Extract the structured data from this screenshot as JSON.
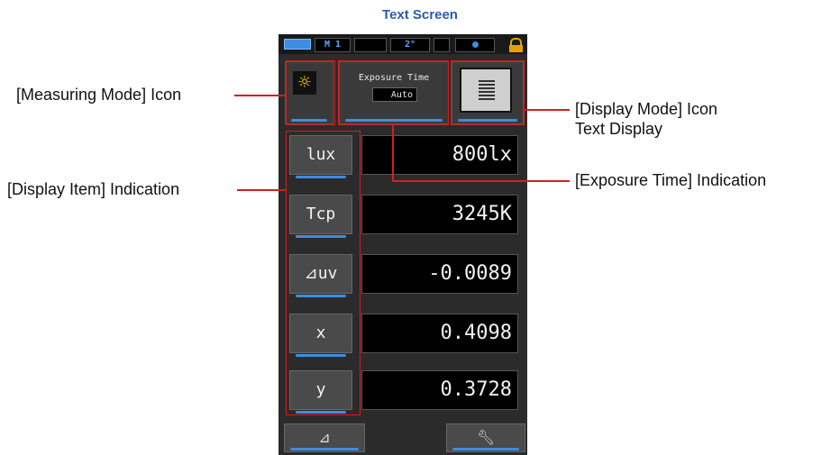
{
  "title": "Text Screen",
  "status_bar": {
    "memory": "M 1",
    "angle": "2°"
  },
  "header": {
    "measuring_mode_icon": "sun-icon",
    "exposure_label": "Exposure Time",
    "exposure_value": "Auto",
    "display_mode_icon": "text-display-icon"
  },
  "items": [
    {
      "label": "lux",
      "value": "800lx"
    },
    {
      "label": "Tcp",
      "value": "3245K"
    },
    {
      "label": "⊿uv",
      "value": "-0.0089"
    },
    {
      "label": "x",
      "value": "0.4098"
    },
    {
      "label": "y",
      "value": "0.3728"
    }
  ],
  "bottom": {
    "delta_button": "⊿",
    "tool_icon": "wrench-icon"
  },
  "annotations": {
    "measuring_mode": "[Measuring Mode] Icon",
    "display_item": "[Display Item] Indication",
    "display_mode_line1": "[Display Mode] Icon",
    "display_mode_line2": "Text Display",
    "exposure_time": "[Exposure Time] Indication"
  },
  "colors": {
    "title": "#2a5ea8",
    "callout": "#d21f1f",
    "accent": "#3d8de0",
    "mode_icon": "#ffcf00"
  }
}
